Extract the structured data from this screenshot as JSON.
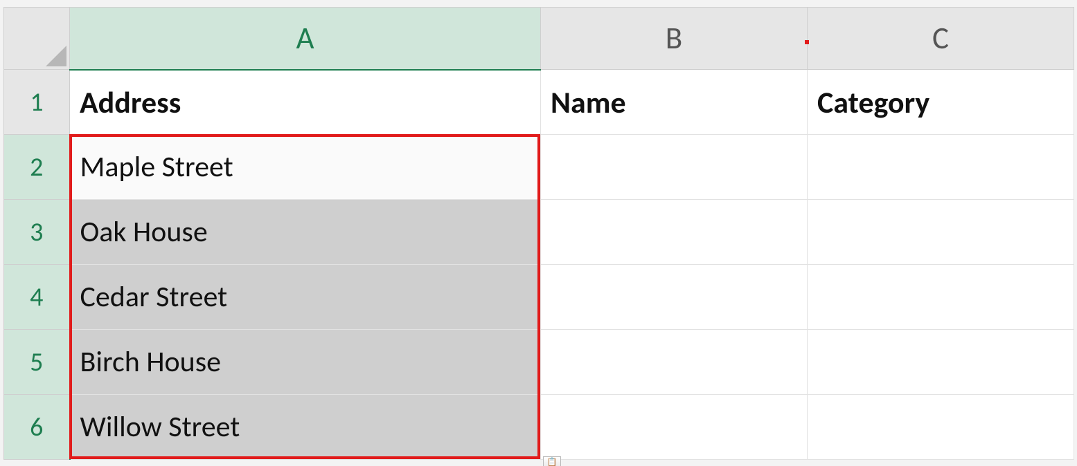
{
  "columns": {
    "A": "A",
    "B": "B",
    "C": "C"
  },
  "rows": {
    "r1": "1",
    "r2": "2",
    "r3": "3",
    "r4": "4",
    "r5": "5",
    "r6": "6"
  },
  "headers": {
    "A": "Address",
    "B": "Name",
    "C": "Category"
  },
  "data": {
    "A2": "Maple Street",
    "A3": "Oak House",
    "A4": "Cedar Street",
    "A5": "Birch House",
    "A6": "Willow Street"
  },
  "selection": {
    "range": "A2:A6",
    "active": "A2"
  },
  "annotation": {
    "paste_options_glyph": "📋"
  }
}
